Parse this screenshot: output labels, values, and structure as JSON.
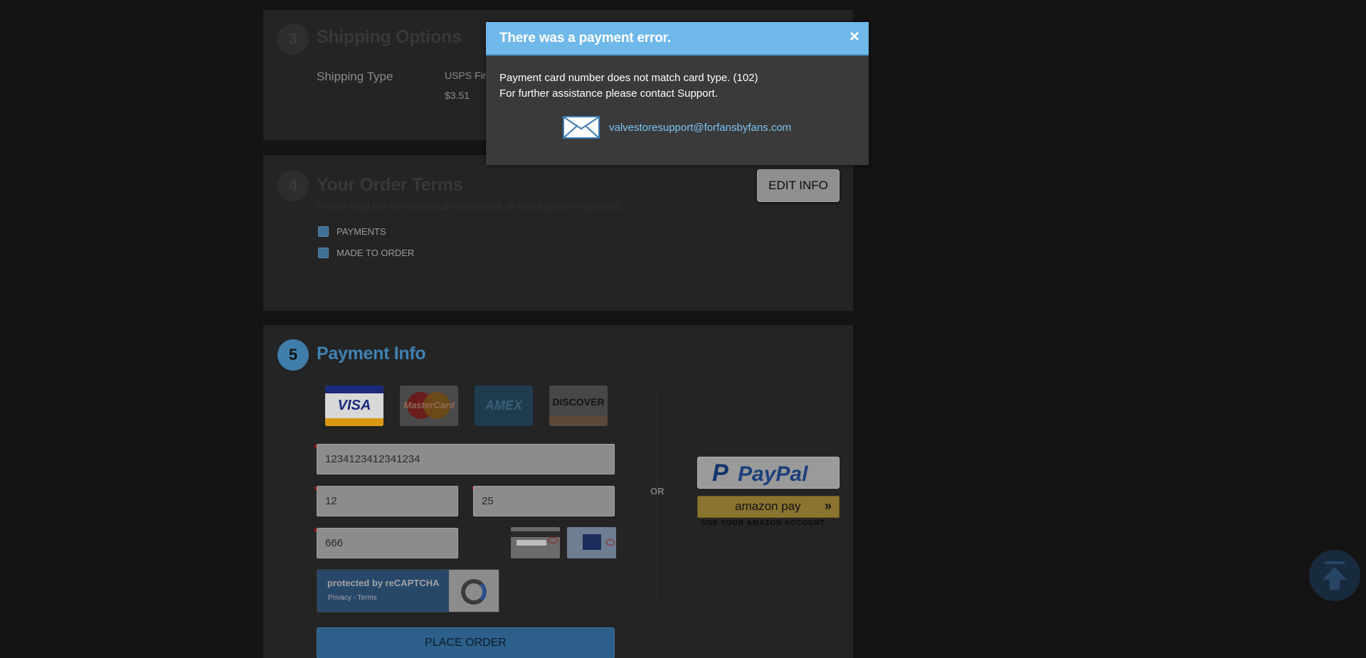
{
  "shipping": {
    "step": "3",
    "title": "Shipping Options",
    "type_label": "Shipping Type",
    "method": "USPS Firs",
    "price": "$3.51"
  },
  "terms": {
    "step": "4",
    "title": "Your Order Terms",
    "note": "Please read the terms carefully and check all checkboxes to proceed.",
    "edit_label": "EDIT INFO",
    "items": [
      "PAYMENTS",
      "MADE TO ORDER"
    ]
  },
  "payment": {
    "step": "5",
    "title": "Payment Info",
    "cards": [
      "VISA",
      "MasterCard",
      "AMEX",
      "DISCOVER"
    ],
    "card_number": "1234123412341234",
    "exp_month": "12",
    "exp_year": "25",
    "cvv": "666",
    "required_mark": "*",
    "or_label": "OR",
    "paypal_label": "PayPal",
    "paypal_p": "P",
    "amazon_label": "amazon pay",
    "amazon_arrow": "»",
    "amazon_sub": "USE YOUR AMAZON ACCOUNT",
    "recaptcha_title": "protected by reCAPTCHA",
    "recaptcha_links": "Privacy - Terms",
    "place_order_label": "PLACE ORDER"
  },
  "modal": {
    "title": "There was a payment error.",
    "close_glyph": "×",
    "message_line1": "Payment card number does not match card type. (102)",
    "message_line2": "For further assistance please contact Support.",
    "support_email": "valvestoresupport@forfansbyfans.com"
  },
  "colors": {
    "modal_header": "#6fb8ea",
    "link": "#7cc3f4",
    "accent": "#3f82b3"
  }
}
